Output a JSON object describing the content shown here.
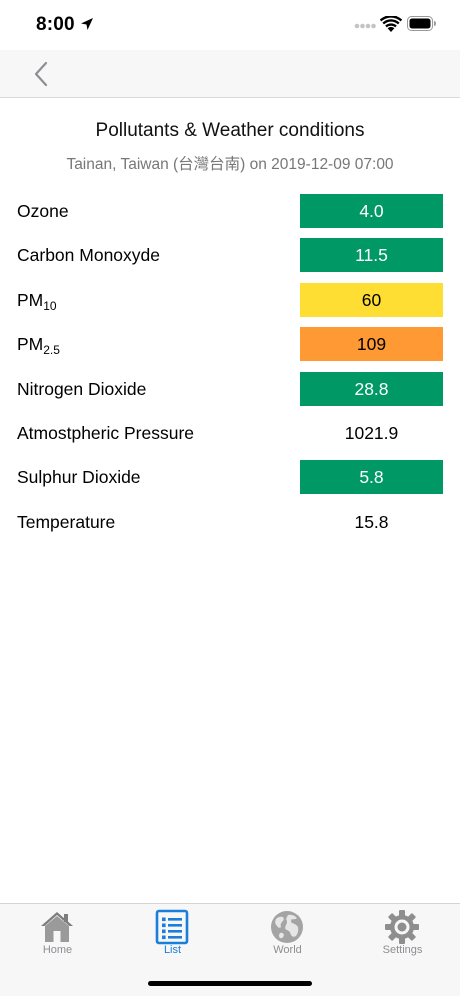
{
  "status_bar": {
    "time": "8:00"
  },
  "header": {
    "title": "Pollutants & Weather conditions",
    "subtitle": "Tainan, Taiwan (台灣台南) on 2019-12-09 07:00"
  },
  "rows": [
    {
      "label": "Ozone",
      "value": "4.0",
      "level": "good",
      "color": "#009966"
    },
    {
      "label": "Carbon Monoxyde",
      "value": "11.5",
      "level": "good",
      "color": "#009966"
    },
    {
      "label": "PM",
      "label_sub": "10",
      "value": "60",
      "level": "moderate",
      "color": "#ffde33"
    },
    {
      "label": "PM",
      "label_sub": "2.5",
      "value": "109",
      "level": "unhealthy-sensitive",
      "color": "#ff9933"
    },
    {
      "label": "Nitrogen Dioxide",
      "value": "28.8",
      "level": "good",
      "color": "#009966"
    },
    {
      "label": "Atmostpheric Pressure",
      "value": "1021.9",
      "level": "none"
    },
    {
      "label": "Sulphur Dioxide",
      "value": "5.8",
      "level": "good",
      "color": "#009966"
    },
    {
      "label": "Temperature",
      "value": "15.8",
      "level": "none"
    }
  ],
  "tabs": [
    {
      "label": "Home",
      "icon": "house-icon",
      "active": false
    },
    {
      "label": "List",
      "icon": "list-icon",
      "active": true
    },
    {
      "label": "World",
      "icon": "globe-icon",
      "active": false
    },
    {
      "label": "Settings",
      "icon": "gear-icon",
      "active": false
    }
  ],
  "colors": {
    "accent": "#1a7fd9",
    "good": "#009966",
    "moderate": "#ffde33",
    "unhealthy_sensitive": "#ff9933"
  }
}
